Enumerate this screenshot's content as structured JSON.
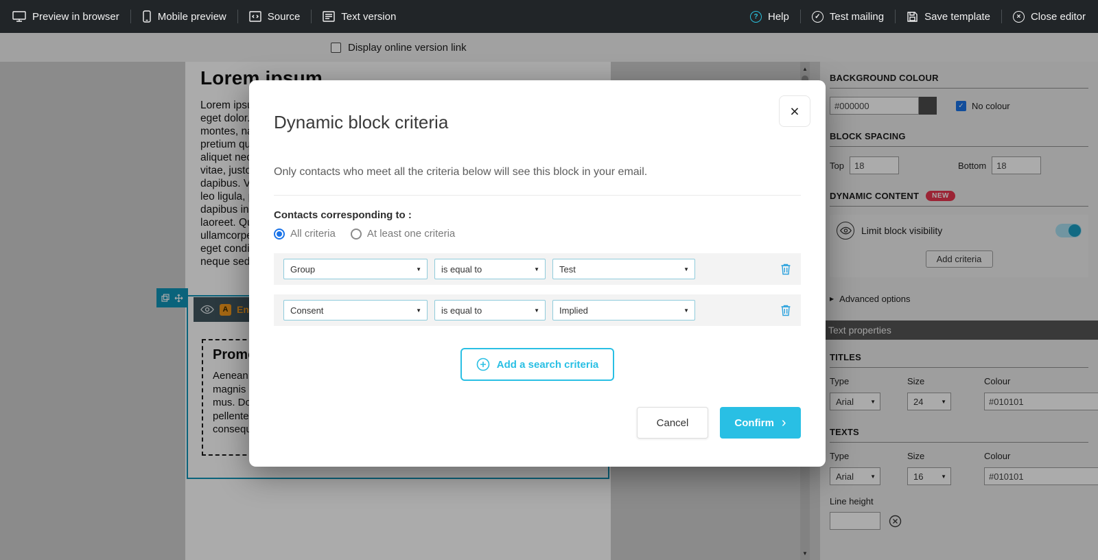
{
  "accent": "#29bfe4",
  "icons": {
    "help": "?",
    "checkmark": "✓",
    "close": "×",
    "select_caret": "▼",
    "advanced_caret": "▶",
    "scroll_up": "▲",
    "scroll_down": "▼",
    "confirm_chevron": "›"
  },
  "topbar": {
    "items_left": [
      {
        "label": "Preview in browser"
      },
      {
        "label": "Mobile preview"
      },
      {
        "label": "Source"
      },
      {
        "label": "Text version"
      }
    ],
    "items_right": [
      {
        "label": "Help"
      },
      {
        "label": "Test mailing"
      },
      {
        "label": "Save template"
      },
      {
        "label": "Close editor"
      }
    ]
  },
  "subbar": {
    "display_online_label": "Display online version link"
  },
  "canvas": {
    "heading": "Lorem ipsum",
    "paragraph": "Lorem ipsum dolor sit amet, consectetuer adipiscing elit. Aenean commodo ligula eget dolor. Aenean massa. Cum sociis natoque penatibus et magnis dis parturient montes, nascetur ridiculus mus. Donec quam felis, ultricies nec, pellentesque eu, pretium quis, sem. Nulla consequat massa quis enim. Donec pede justo, fringilla vel, aliquet nec, vulputate eget, arcu. In enim justo, rhoncus ut, imperdiet a, venenatis vitae, justo. Nullam dictum felis eu pede mollis pretium. Integer tincidunt. Cras dapibus. Vivamus elementum semper nisi. Aenean vulputate eleifend tellus. Aenean leo ligula, porttitor eu, consequat vitae, eleifend ac, enim. Aliquam lorem ante, dapibus in, viverra quis, feugiat a, tellus. Phasellus viverra nulla ut metus varius laoreet. Quisque rutrum. Aenean imperdiet. Etiam ultricies nisi vel augue. Curabitur ullamcorper ultricies nisi. Nam eget dui. Etiam rhoncus. Maecenas tempus, tellus eget condimentum rhoncus, sem quam semper libero, sit amet adipiscing sem neque sed ipsum. Nam quam nunc, blandit vel, luctus pulvinar, hendrerit id, lorem.",
    "block_badge": "A",
    "block_label": "En",
    "promo_heading": "Promotion",
    "promo_paragraph": "Aenean massa. Cum sociis natoque penatibus et magnis dis parturient montes, nascetur ridiculus mus. Donec quam felis, ultricies nec, pellentesque eu, pretium quis, sem. Nulla consequat massa quis enim."
  },
  "modal": {
    "title": "Dynamic block criteria",
    "description": "Only contacts who meet all the criteria below will see this block in your email.",
    "contacts_label": "Contacts corresponding to :",
    "radio_all_label": "All criteria",
    "radio_any_label": "At least one criteria",
    "criteria": [
      {
        "field": "Group",
        "operator": "is equal to",
        "value": "Test"
      },
      {
        "field": "Consent",
        "operator": "is equal to",
        "value": "Implied"
      }
    ],
    "add_criteria_label": "Add a search criteria",
    "cancel_label": "Cancel",
    "confirm_label": "Confirm"
  },
  "sidebar": {
    "background_colour": {
      "title": "BACKGROUND COLOUR",
      "hex": "#000000",
      "no_colour_label": "No colour"
    },
    "block_spacing": {
      "title": "BLOCK SPACING",
      "top_label": "Top",
      "top_value": "18",
      "bottom_label": "Bottom",
      "bottom_value": "18"
    },
    "dynamic_content": {
      "title": "DYNAMIC CONTENT",
      "badge": "NEW",
      "limit_visibility_label": "Limit block visibility",
      "add_criteria_label": "Add criteria",
      "advanced_options_label": "Advanced options"
    },
    "text_properties": {
      "header": "Text properties"
    },
    "titles": {
      "title": "TITLES",
      "type_label": "Type",
      "type_value": "Arial",
      "size_label": "Size",
      "size_value": "24",
      "colour_label": "Colour",
      "colour_value": "#010101"
    },
    "texts": {
      "title": "TEXTS",
      "type_label": "Type",
      "type_value": "Arial",
      "size_label": "Size",
      "size_value": "16",
      "colour_label": "Colour",
      "colour_value": "#010101",
      "line_height_label": "Line height",
      "line_height_value": ""
    }
  }
}
